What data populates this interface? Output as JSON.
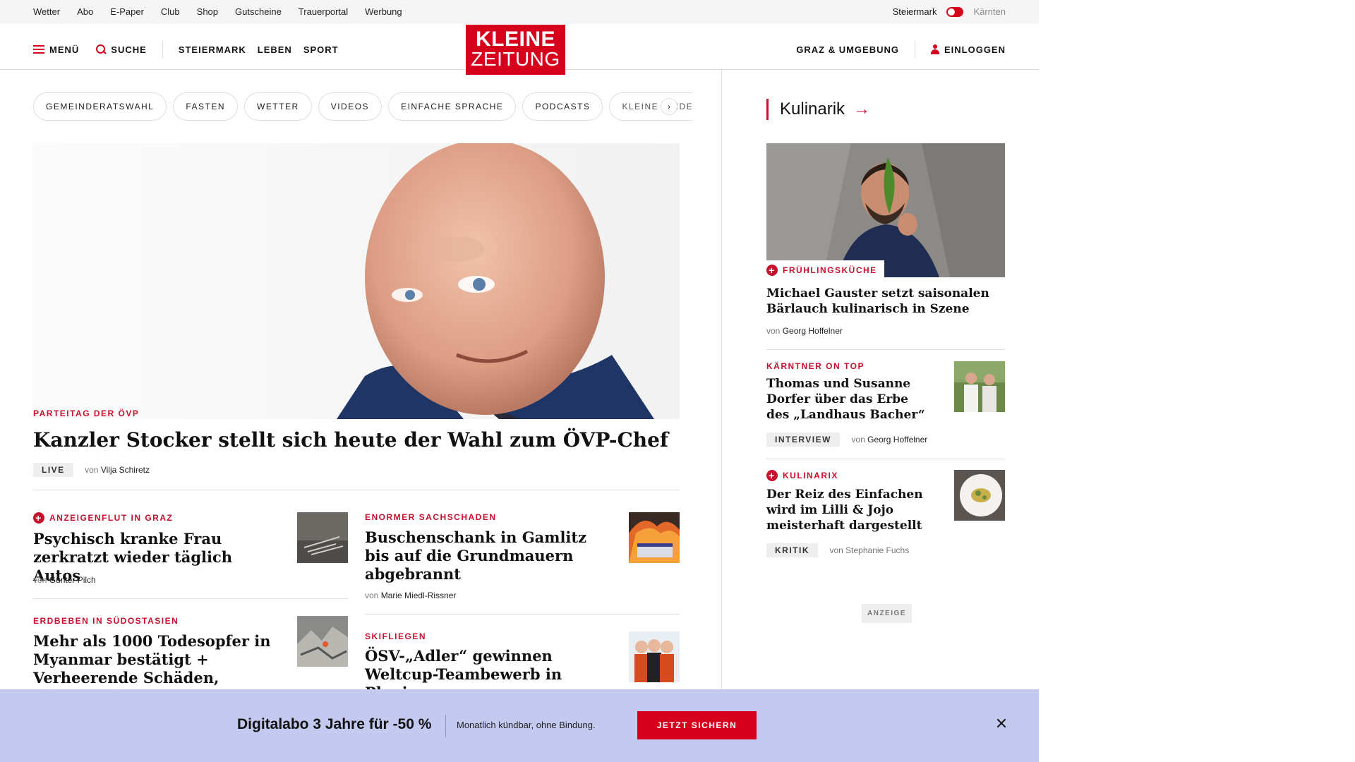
{
  "topbar": {
    "links": [
      "Wetter",
      "Abo",
      "E-Paper",
      "Club",
      "Shop",
      "Gutscheine",
      "Trauerportal",
      "Werbung"
    ],
    "region_active": "Steiermark",
    "region_inactive": "Kärnten"
  },
  "header": {
    "menu": "MENÜ",
    "search": "SUCHE",
    "nav": [
      "STEIERMARK",
      "LEBEN",
      "SPORT"
    ],
    "logo_line1": "KLEINE",
    "logo_line2": "ZEITUNG",
    "local": "GRAZ & UMGEBUNG",
    "login": "EINLOGGEN"
  },
  "chips": [
    "GEMEINDERATSWAHL",
    "FASTEN",
    "WETTER",
    "VIDEOS",
    "EINFACHE SPRACHE",
    "PODCASTS",
    "KLEINE KINDE"
  ],
  "hero": {
    "kicker": "PARTEITAG DER ÖVP",
    "headline": "Kanzler Stocker stellt sich heute der Wahl zum ÖVP-Chef",
    "tag": "LIVE",
    "von": "von",
    "author": "Vilja Schiretz"
  },
  "articles": [
    {
      "kicker": "ANZEIGENFLUT IN GRAZ",
      "plus": true,
      "headline": "Psychisch kranke Frau zerkratzt wieder täglich Autos",
      "von": "von",
      "author": "Günter Pilch"
    },
    {
      "kicker": "ENORMER SACHSCHADEN",
      "plus": false,
      "headline": "Buschenschank in Gamlitz bis auf die Grundmauern abgebrannt",
      "von": "von",
      "author": "Marie Miedl-Rissner"
    },
    {
      "kicker": "ERDBEBEN IN SÜDOSTASIEN",
      "plus": false,
      "headline": "Mehr als 1000 Todesopfer in Myanmar bestätigt + Verheerende Schäden, Dämme könnten brechen"
    },
    {
      "kicker": "SKIFLIEGEN",
      "plus": false,
      "headline": "ÖSV-„Adler“ gewinnen Weltcup-Teambewerb in Planica"
    }
  ],
  "sidebar": {
    "section": "Kulinarik",
    "feature": {
      "kicker": "FRÜHLINGSKÜCHE",
      "headline": "Michael Gauster setzt saisonalen Bärlauch kulinarisch in Szene",
      "von": "von",
      "author": "Georg Hoffelner"
    },
    "items": [
      {
        "kicker": "KÄRNTNER ON TOP",
        "plus": false,
        "headline": "Thomas und Susanne Dorfer über das Erbe des „Landhaus Bacher“",
        "tag": "INTERVIEW",
        "von": "von",
        "author": "Georg Hoffelner"
      },
      {
        "kicker": "KULINARIX",
        "plus": true,
        "headline": "Der Reiz des Einfachen wird im Lilli & Jojo meisterhaft dargestellt",
        "tag": "KRITIK",
        "von": "von",
        "author": "Stephanie Fuchs"
      }
    ],
    "ad_label": "ANZEIGE"
  },
  "promo": {
    "title": "Digitalabo 3 Jahre für -50 %",
    "subtitle": "Monatlich kündbar, ohne Bindung.",
    "cta": "JETZT SICHERN"
  },
  "colors": {
    "brand": "#d6001c",
    "kicker": "#c8102e",
    "promo_bg": "#c4c9ef"
  }
}
